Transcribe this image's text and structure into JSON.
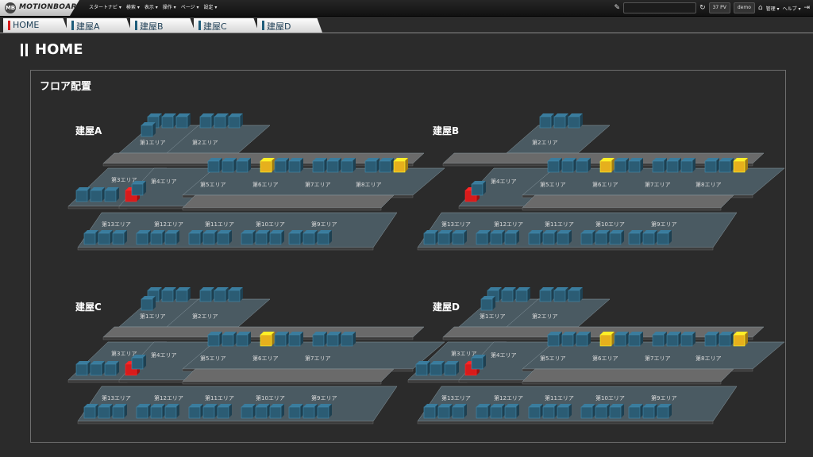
{
  "app": {
    "logo_text": "MOTIONBOARD",
    "logo_mark": "MB"
  },
  "menu": [
    {
      "label": "スタートナビ ▾"
    },
    {
      "label": "検索 ▾"
    },
    {
      "label": "表示 ▾"
    },
    {
      "label": "操作 ▾"
    },
    {
      "label": "ページ ▾"
    },
    {
      "label": "設定 ▾"
    }
  ],
  "toolbar": {
    "pv_label": "37 PV",
    "user": "demo",
    "admin": "管理 ▾",
    "help": "ヘルプ ▾",
    "chat_icon": "chat-icon",
    "refresh_icon": "refresh-icon",
    "home_icon": "home-icon",
    "logout_icon": "logout-icon"
  },
  "tabs": [
    {
      "label": "HOME",
      "active": true
    },
    {
      "label": "建屋A",
      "active": false
    },
    {
      "label": "建屋B",
      "active": false
    },
    {
      "label": "建屋C",
      "active": false
    },
    {
      "label": "建屋D",
      "active": false
    }
  ],
  "page_title": "HOME",
  "panel_title": "フロア配置",
  "colors": {
    "normal": "#2b5c74",
    "warning": "#e6b01d",
    "alert": "#d81b1b",
    "floor": "#4a5a62",
    "aisle": "#6a6a6a"
  },
  "buildings": [
    {
      "name": "建屋A",
      "areas": [
        "第1エリア",
        "第2エリア",
        "第3エリア",
        "第4エリア",
        "第5エリア",
        "第6エリア",
        "第7エリア",
        "第8エリア",
        "第13エリア",
        "第12エリア",
        "第11エリア",
        "第10エリア",
        "第9エリア"
      ]
    },
    {
      "name": "建屋B",
      "areas": [
        "第2エリア",
        "第4エリア",
        "第5エリア",
        "第6エリア",
        "第7エリア",
        "第8エリア",
        "第13エリア",
        "第12エリア",
        "第11エリア",
        "第10エリア",
        "第9エリア"
      ]
    },
    {
      "name": "建屋C",
      "areas": [
        "第1エリア",
        "第2エリア",
        "第3エリア",
        "第4エリア",
        "第5エリア",
        "第6エリア",
        "第7エリア",
        "第13エリア",
        "第12エリア",
        "第11エリア",
        "第10エリア",
        "第9エリア"
      ]
    },
    {
      "name": "建屋D",
      "areas": [
        "第1エリア",
        "第2エリア",
        "第3エリア",
        "第4エリア",
        "第5エリア",
        "第6エリア",
        "第7エリア",
        "第8エリア",
        "第13エリア",
        "第12エリア",
        "第11エリア",
        "第10エリア",
        "第9エリア"
      ]
    }
  ]
}
